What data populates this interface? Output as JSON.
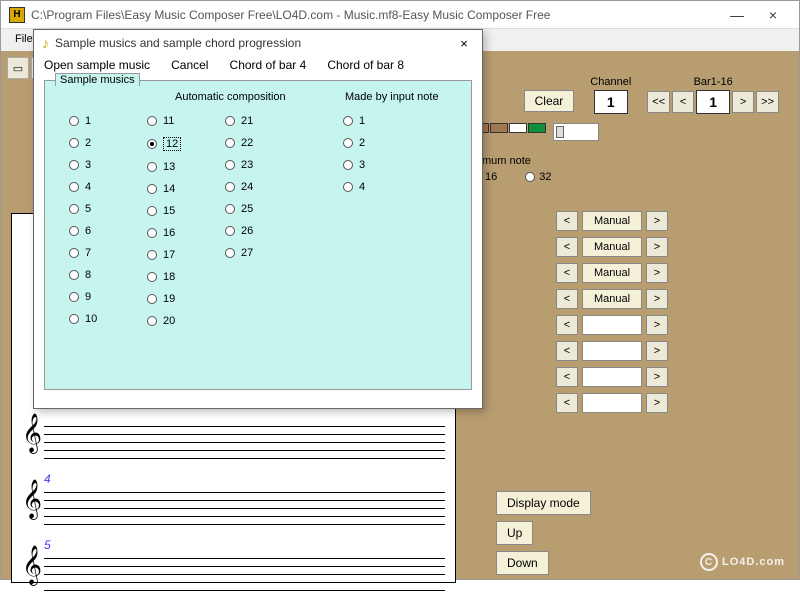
{
  "window": {
    "title": "C:\\Program Files\\Easy Music Composer Free\\LO4D.com - Music.mf8-Easy Music Composer Free",
    "icon_letter": "H",
    "minimize": "—",
    "close": "×"
  },
  "menubar": {
    "file": "File"
  },
  "controls": {
    "clear": "Clear",
    "channel_label": "Channel",
    "channel_value": "1",
    "bar_label": "Bar1-16",
    "bar_value": "1",
    "nav_first": "<<",
    "nav_prev": "<",
    "nav_next": ">",
    "nav_last": ">>"
  },
  "swatches": [
    "#a07850",
    "#a07850",
    "#ffffff",
    "#109038"
  ],
  "min_note": {
    "label": "inimum note",
    "opt16": "16",
    "opt32": "32",
    "selected": "16"
  },
  "manual_rows": [
    {
      "label": "Manual",
      "filled": true
    },
    {
      "label": "Manual",
      "filled": true
    },
    {
      "label": "Manual",
      "filled": true
    },
    {
      "label": "Manual",
      "filled": true
    },
    {
      "label": "",
      "filled": false
    },
    {
      "label": "",
      "filled": false
    },
    {
      "label": "",
      "filled": false
    },
    {
      "label": "",
      "filled": false
    }
  ],
  "bottom": {
    "display_mode": "Display mode",
    "up": "Up",
    "down": "Down"
  },
  "staff": {
    "n4": "4",
    "n5": "5"
  },
  "dialog": {
    "title": "Sample musics and sample chord progression",
    "close": "×",
    "menu": {
      "open": "Open sample music",
      "cancel": "Cancel",
      "chord4": "Chord of bar 4",
      "chord8": "Chord of bar 8"
    },
    "legend": "Sample musics",
    "header_auto": "Automatic composition",
    "header_manual": "Made by input note",
    "auto_col1": [
      "1",
      "2",
      "3",
      "4",
      "5",
      "6",
      "7",
      "8",
      "9",
      "10"
    ],
    "auto_col2": [
      "11",
      "12",
      "13",
      "14",
      "15",
      "16",
      "17",
      "18",
      "19",
      "20"
    ],
    "auto_col3": [
      "21",
      "22",
      "23",
      "24",
      "25",
      "26",
      "27"
    ],
    "manual_col": [
      "1",
      "2",
      "3",
      "4"
    ],
    "selected": "12"
  },
  "watermark": "LO4D.com"
}
